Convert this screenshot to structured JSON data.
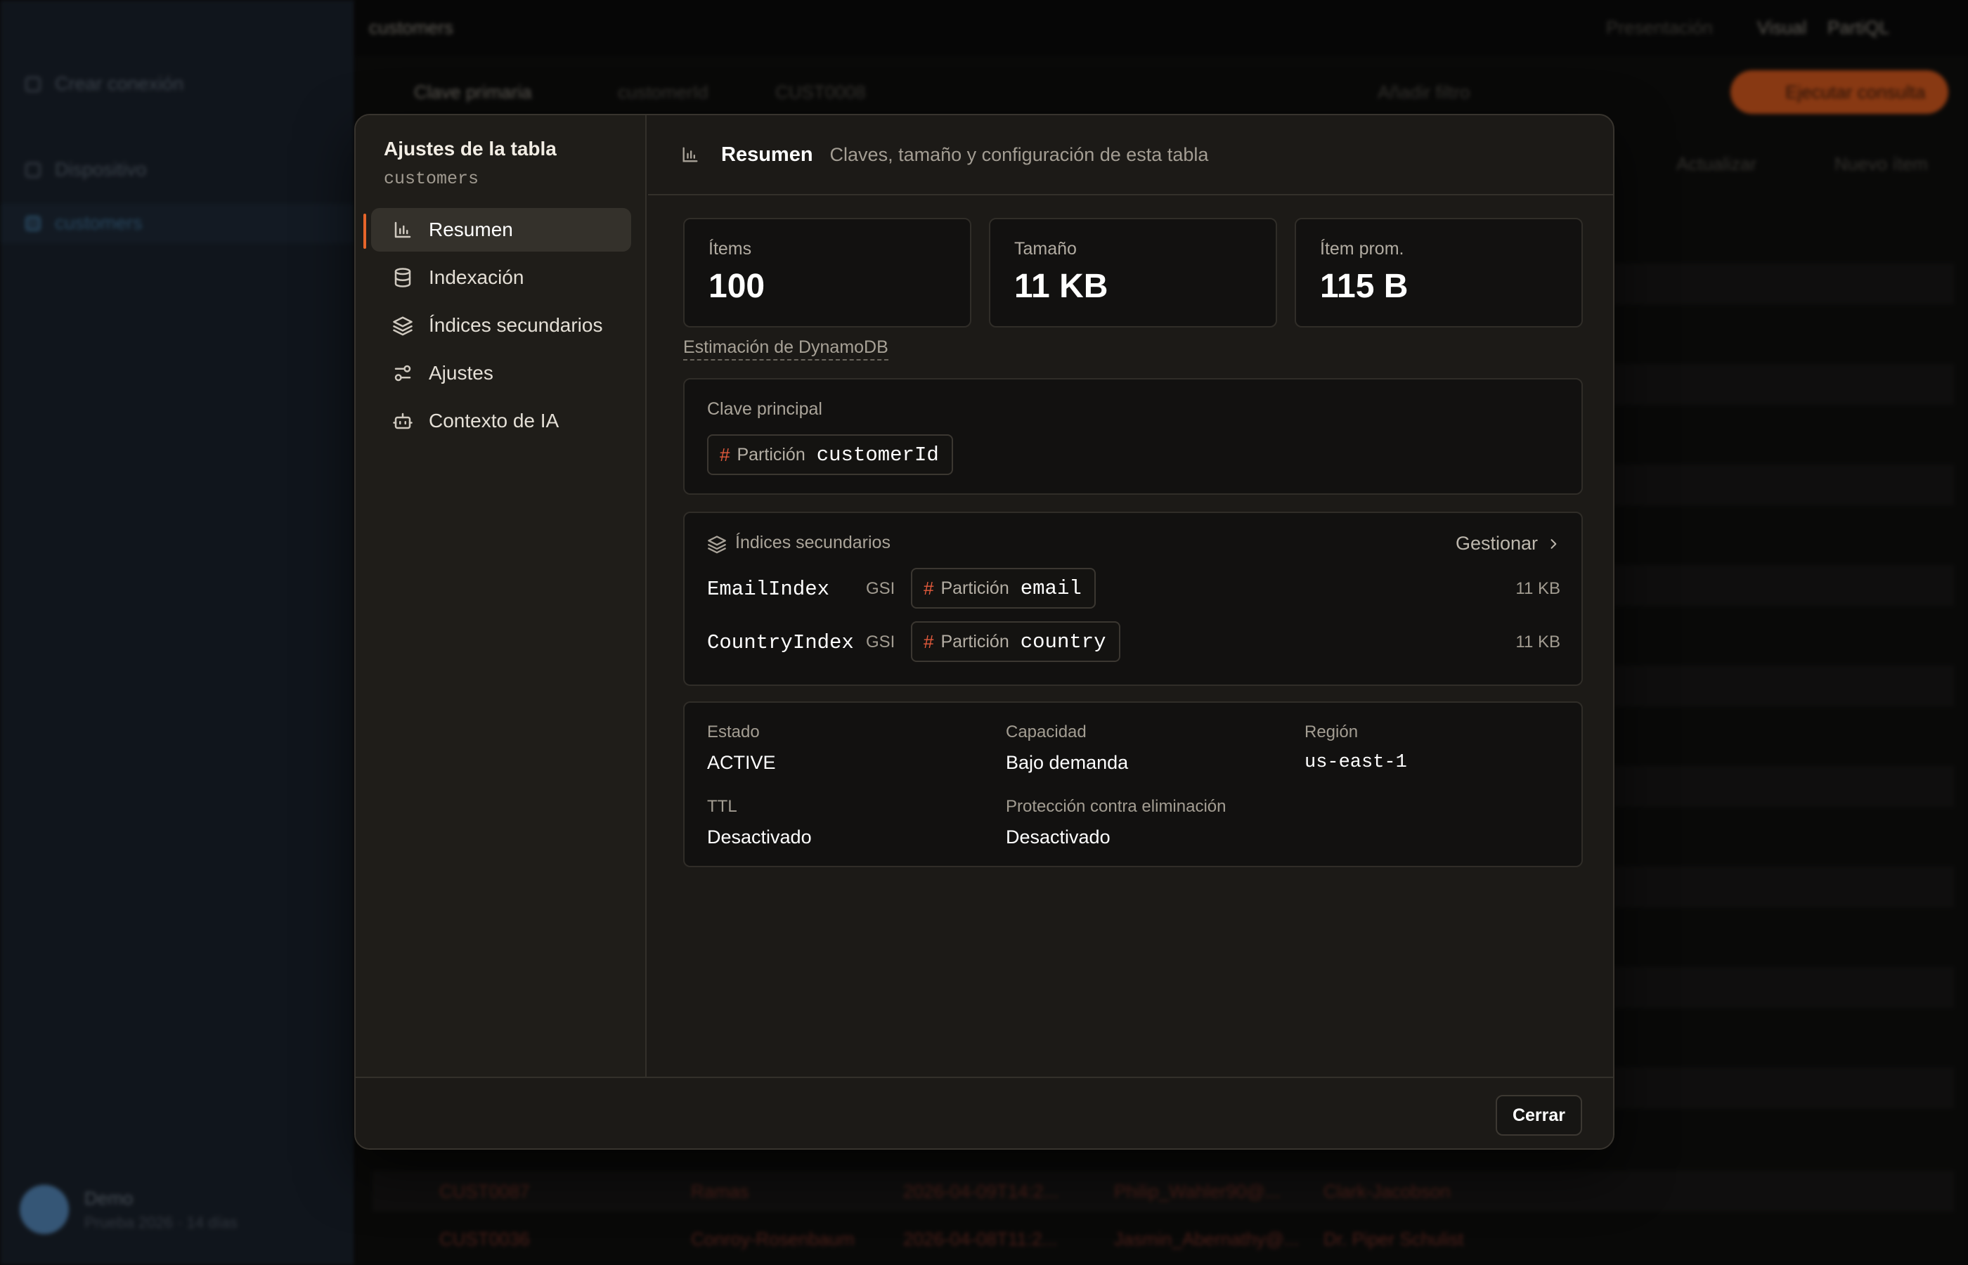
{
  "background": {
    "sidebar": {
      "new_connection": "Crear conexión",
      "group": "Dispositivo",
      "active_table": "customers",
      "user_name": "Demo",
      "user_sub": "Prueba 2026 · 14 días"
    },
    "topbar": {
      "table_name": "customers",
      "mode_pill": "Presentación",
      "view_a": "Visual",
      "view_b": "PartiQL",
      "primary_key_filter": "Clave primaria",
      "partition_value": "customerId",
      "partition_sample": "CUST0008",
      "add_filter": "Añadir filtro",
      "run_query": "Ejecutar consulta",
      "refresh": "Actualizar",
      "new_item": "Nuevo ítem"
    },
    "rows": [
      [
        "CUST0087",
        "Ramas",
        "2026-04-09T14:2...",
        "Philip_Wahler90@...",
        "Clark-Jacobson"
      ],
      [
        "CUST0036",
        "Conroy-Rosenbaum",
        "2026-04-08T11:2...",
        "Jasmin_Abernathy@...",
        "Dr. Piper Schulist"
      ]
    ]
  },
  "modal": {
    "nav": {
      "title": "Ajustes de la tabla",
      "table_name": "customers",
      "items": [
        {
          "label": "Resumen",
          "icon": "bar-chart-icon",
          "active": true
        },
        {
          "label": "Indexación",
          "icon": "database-icon",
          "active": false
        },
        {
          "label": "Índices secundarios",
          "icon": "layers-icon",
          "active": false
        },
        {
          "label": "Ajustes",
          "icon": "sliders-icon",
          "active": false
        },
        {
          "label": "Contexto de IA",
          "icon": "bot-icon",
          "active": false
        }
      ]
    },
    "header": {
      "title": "Resumen",
      "description": "Claves, tamaño y configuración de esta tabla"
    },
    "stats": [
      {
        "label": "Ítems",
        "value": "100"
      },
      {
        "label": "Tamaño",
        "value": "11 KB"
      },
      {
        "label": "Ítem prom.",
        "value": "115 B"
      }
    ],
    "estimate_note": "Estimación de DynamoDB",
    "primary_key": {
      "label": "Clave principal",
      "key_type": "Partición",
      "key_name": "customerId"
    },
    "secondary_indexes": {
      "label": "Índices secundarios",
      "manage_label": "Gestionar",
      "items": [
        {
          "name": "EmailIndex",
          "type": "GSI",
          "key_type": "Partición",
          "key_name": "email",
          "size": "11 KB"
        },
        {
          "name": "CountryIndex",
          "type": "GSI",
          "key_type": "Partición",
          "key_name": "country",
          "size": "11 KB"
        }
      ]
    },
    "properties": {
      "status_label": "Estado",
      "status_value": "ACTIVE",
      "capacity_label": "Capacidad",
      "capacity_value": "Bajo demanda",
      "region_label": "Región",
      "region_value": "us-east-1",
      "ttl_label": "TTL",
      "ttl_value": "Desactivado",
      "deletion_label": "Protección contra eliminación",
      "deletion_value": "Desactivado"
    },
    "footer": {
      "close_label": "Cerrar"
    },
    "colors": {
      "accent": "#e7652a",
      "hash": "#e25a3c",
      "panel": "#1c1a17",
      "card": "#121110"
    }
  }
}
